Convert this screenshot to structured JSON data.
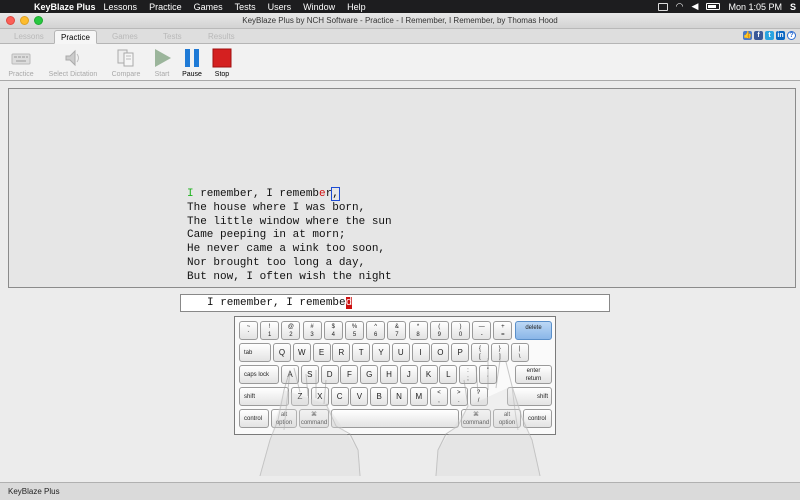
{
  "menubar": {
    "app_name": "KeyBlaze Plus",
    "items": [
      "Lessons",
      "Practice",
      "Games",
      "Tests",
      "Users",
      "Window",
      "Help"
    ],
    "clock": "Mon 1:05 PM",
    "user_initial": "S"
  },
  "window": {
    "title": "KeyBlaze Plus by NCH Software - Practice - I Remember, I Remember, by Thomas Hood"
  },
  "tabs": [
    {
      "label": "Lessons",
      "active": false
    },
    {
      "label": "Practice",
      "active": true
    },
    {
      "label": "Games",
      "active": false
    },
    {
      "label": "Tests",
      "active": false
    },
    {
      "label": "Results",
      "active": false
    }
  ],
  "toolbar": {
    "practice": "Practice",
    "select_dictation": "Select Dictation",
    "compare": "Compare",
    "start": "Start",
    "pause": "Pause",
    "stop": "Stop"
  },
  "passage": {
    "line1_first_char": "I",
    "line1_middle": " remember, I rememb",
    "line1_error_char": "e",
    "line1_rest": "r",
    "line1_cursor_char": ",",
    "lines": [
      "The house where I was born,",
      "The little window where the sun",
      "Came peeping in at morn;",
      "He never came a wink too soon,",
      "Nor brought too long a day,",
      "But now, I often wish the night"
    ]
  },
  "input": {
    "typed": "I remember, I remembe",
    "wrong_char": "d"
  },
  "keyboard": {
    "row1": [
      [
        "~",
        "`"
      ],
      [
        "!",
        "1"
      ],
      [
        "@",
        "2"
      ],
      [
        "#",
        "3"
      ],
      [
        "$",
        "4"
      ],
      [
        "%",
        "5"
      ],
      [
        "^",
        "6"
      ],
      [
        "&",
        "7"
      ],
      [
        "*",
        "8"
      ],
      [
        "(",
        "9"
      ],
      [
        ")",
        "0"
      ],
      [
        "—",
        "-"
      ],
      [
        "+",
        "="
      ]
    ],
    "delete": "delete",
    "tab": "tab",
    "row2": [
      "Q",
      "W",
      "E",
      "R",
      "T",
      "Y",
      "U",
      "I",
      "O",
      "P"
    ],
    "row2_sym": [
      [
        "{",
        "["
      ],
      [
        "}",
        "]"
      ],
      [
        "|",
        "\\"
      ]
    ],
    "caps": "caps lock",
    "row3": [
      "A",
      "S",
      "D",
      "F",
      "G",
      "H",
      "J",
      "K",
      "L"
    ],
    "row3_sym": [
      [
        ":",
        ";"
      ],
      [
        "\"",
        "'"
      ]
    ],
    "enter": "enter\nreturn",
    "shift": "shift",
    "row4": [
      "Z",
      "X",
      "C",
      "V",
      "B",
      "N",
      "M"
    ],
    "row4_sym": [
      [
        "<",
        ","
      ],
      [
        ">",
        "."
      ],
      [
        "?",
        "/"
      ]
    ],
    "control": "control",
    "alt_option": "alt\noption",
    "command_symbol": "⌘",
    "command": "command"
  },
  "status": {
    "text": "KeyBlaze Plus"
  },
  "colors": {
    "correct": "#1db31d",
    "error": "#cc1111",
    "highlight_key": "#8ab6e8"
  }
}
